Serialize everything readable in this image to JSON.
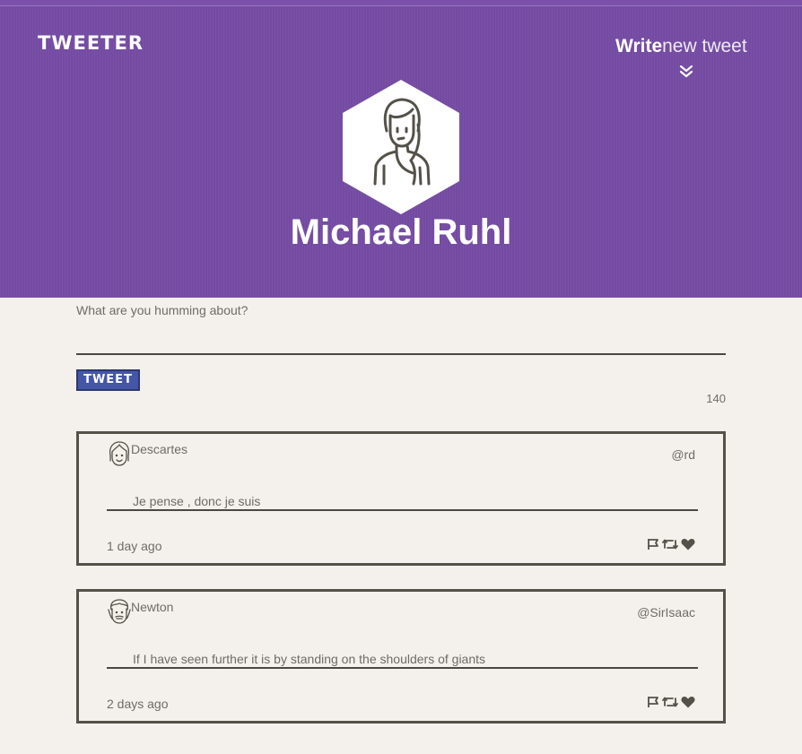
{
  "colors": {
    "header_bg": "#744ba2",
    "page_bg": "#f4f1ec",
    "text": "#545149",
    "button_bg": "#4556a6"
  },
  "header": {
    "logo": "TWEETER",
    "compose_toggle": {
      "bold": "Write",
      "light": "new tweet",
      "icon": "chevron-double-down-icon"
    },
    "profile_name": "Michael Ruhl",
    "avatar_icon": "woman-avatar-icon"
  },
  "composer": {
    "prompt": "What are you humming about?",
    "button_label": "TWEET",
    "counter": "140"
  },
  "tweets": [
    {
      "user": "Descartes",
      "handle": "@rd",
      "avatar_icon": "face-avatar-icon",
      "text": "Je pense , donc je suis",
      "age": "1 day ago",
      "actions": [
        "flag-icon",
        "retweet-icon",
        "heart-icon"
      ]
    },
    {
      "user": "Newton",
      "handle": "@SirIsaac",
      "avatar_icon": "face-avatar-icon",
      "text": "If I have seen further it is by standing on the shoulders of giants",
      "age": "2 days ago",
      "actions": [
        "flag-icon",
        "retweet-icon",
        "heart-icon"
      ]
    }
  ]
}
